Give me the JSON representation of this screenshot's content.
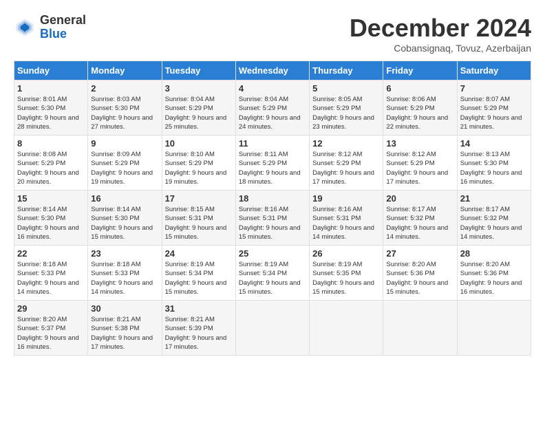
{
  "logo": {
    "general": "General",
    "blue": "Blue"
  },
  "title": "December 2024",
  "subtitle": "Cobansignaq, Tovuz, Azerbaijan",
  "headers": [
    "Sunday",
    "Monday",
    "Tuesday",
    "Wednesday",
    "Thursday",
    "Friday",
    "Saturday"
  ],
  "weeks": [
    [
      {
        "day": "1",
        "sunrise": "Sunrise: 8:01 AM",
        "sunset": "Sunset: 5:30 PM",
        "daylight": "Daylight: 9 hours and 28 minutes."
      },
      {
        "day": "2",
        "sunrise": "Sunrise: 8:03 AM",
        "sunset": "Sunset: 5:30 PM",
        "daylight": "Daylight: 9 hours and 27 minutes."
      },
      {
        "day": "3",
        "sunrise": "Sunrise: 8:04 AM",
        "sunset": "Sunset: 5:29 PM",
        "daylight": "Daylight: 9 hours and 25 minutes."
      },
      {
        "day": "4",
        "sunrise": "Sunrise: 8:04 AM",
        "sunset": "Sunset: 5:29 PM",
        "daylight": "Daylight: 9 hours and 24 minutes."
      },
      {
        "day": "5",
        "sunrise": "Sunrise: 8:05 AM",
        "sunset": "Sunset: 5:29 PM",
        "daylight": "Daylight: 9 hours and 23 minutes."
      },
      {
        "day": "6",
        "sunrise": "Sunrise: 8:06 AM",
        "sunset": "Sunset: 5:29 PM",
        "daylight": "Daylight: 9 hours and 22 minutes."
      },
      {
        "day": "7",
        "sunrise": "Sunrise: 8:07 AM",
        "sunset": "Sunset: 5:29 PM",
        "daylight": "Daylight: 9 hours and 21 minutes."
      }
    ],
    [
      {
        "day": "8",
        "sunrise": "Sunrise: 8:08 AM",
        "sunset": "Sunset: 5:29 PM",
        "daylight": "Daylight: 9 hours and 20 minutes."
      },
      {
        "day": "9",
        "sunrise": "Sunrise: 8:09 AM",
        "sunset": "Sunset: 5:29 PM",
        "daylight": "Daylight: 9 hours and 19 minutes."
      },
      {
        "day": "10",
        "sunrise": "Sunrise: 8:10 AM",
        "sunset": "Sunset: 5:29 PM",
        "daylight": "Daylight: 9 hours and 19 minutes."
      },
      {
        "day": "11",
        "sunrise": "Sunrise: 8:11 AM",
        "sunset": "Sunset: 5:29 PM",
        "daylight": "Daylight: 9 hours and 18 minutes."
      },
      {
        "day": "12",
        "sunrise": "Sunrise: 8:12 AM",
        "sunset": "Sunset: 5:29 PM",
        "daylight": "Daylight: 9 hours and 17 minutes."
      },
      {
        "day": "13",
        "sunrise": "Sunrise: 8:12 AM",
        "sunset": "Sunset: 5:29 PM",
        "daylight": "Daylight: 9 hours and 17 minutes."
      },
      {
        "day": "14",
        "sunrise": "Sunrise: 8:13 AM",
        "sunset": "Sunset: 5:30 PM",
        "daylight": "Daylight: 9 hours and 16 minutes."
      }
    ],
    [
      {
        "day": "15",
        "sunrise": "Sunrise: 8:14 AM",
        "sunset": "Sunset: 5:30 PM",
        "daylight": "Daylight: 9 hours and 16 minutes."
      },
      {
        "day": "16",
        "sunrise": "Sunrise: 8:14 AM",
        "sunset": "Sunset: 5:30 PM",
        "daylight": "Daylight: 9 hours and 15 minutes."
      },
      {
        "day": "17",
        "sunrise": "Sunrise: 8:15 AM",
        "sunset": "Sunset: 5:31 PM",
        "daylight": "Daylight: 9 hours and 15 minutes."
      },
      {
        "day": "18",
        "sunrise": "Sunrise: 8:16 AM",
        "sunset": "Sunset: 5:31 PM",
        "daylight": "Daylight: 9 hours and 15 minutes."
      },
      {
        "day": "19",
        "sunrise": "Sunrise: 8:16 AM",
        "sunset": "Sunset: 5:31 PM",
        "daylight": "Daylight: 9 hours and 14 minutes."
      },
      {
        "day": "20",
        "sunrise": "Sunrise: 8:17 AM",
        "sunset": "Sunset: 5:32 PM",
        "daylight": "Daylight: 9 hours and 14 minutes."
      },
      {
        "day": "21",
        "sunrise": "Sunrise: 8:17 AM",
        "sunset": "Sunset: 5:32 PM",
        "daylight": "Daylight: 9 hours and 14 minutes."
      }
    ],
    [
      {
        "day": "22",
        "sunrise": "Sunrise: 8:18 AM",
        "sunset": "Sunset: 5:33 PM",
        "daylight": "Daylight: 9 hours and 14 minutes."
      },
      {
        "day": "23",
        "sunrise": "Sunrise: 8:18 AM",
        "sunset": "Sunset: 5:33 PM",
        "daylight": "Daylight: 9 hours and 14 minutes."
      },
      {
        "day": "24",
        "sunrise": "Sunrise: 8:19 AM",
        "sunset": "Sunset: 5:34 PM",
        "daylight": "Daylight: 9 hours and 15 minutes."
      },
      {
        "day": "25",
        "sunrise": "Sunrise: 8:19 AM",
        "sunset": "Sunset: 5:34 PM",
        "daylight": "Daylight: 9 hours and 15 minutes."
      },
      {
        "day": "26",
        "sunrise": "Sunrise: 8:19 AM",
        "sunset": "Sunset: 5:35 PM",
        "daylight": "Daylight: 9 hours and 15 minutes."
      },
      {
        "day": "27",
        "sunrise": "Sunrise: 8:20 AM",
        "sunset": "Sunset: 5:36 PM",
        "daylight": "Daylight: 9 hours and 15 minutes."
      },
      {
        "day": "28",
        "sunrise": "Sunrise: 8:20 AM",
        "sunset": "Sunset: 5:36 PM",
        "daylight": "Daylight: 9 hours and 16 minutes."
      }
    ],
    [
      {
        "day": "29",
        "sunrise": "Sunrise: 8:20 AM",
        "sunset": "Sunset: 5:37 PM",
        "daylight": "Daylight: 9 hours and 16 minutes."
      },
      {
        "day": "30",
        "sunrise": "Sunrise: 8:21 AM",
        "sunset": "Sunset: 5:38 PM",
        "daylight": "Daylight: 9 hours and 17 minutes."
      },
      {
        "day": "31",
        "sunrise": "Sunrise: 8:21 AM",
        "sunset": "Sunset: 5:39 PM",
        "daylight": "Daylight: 9 hours and 17 minutes."
      },
      null,
      null,
      null,
      null
    ]
  ]
}
